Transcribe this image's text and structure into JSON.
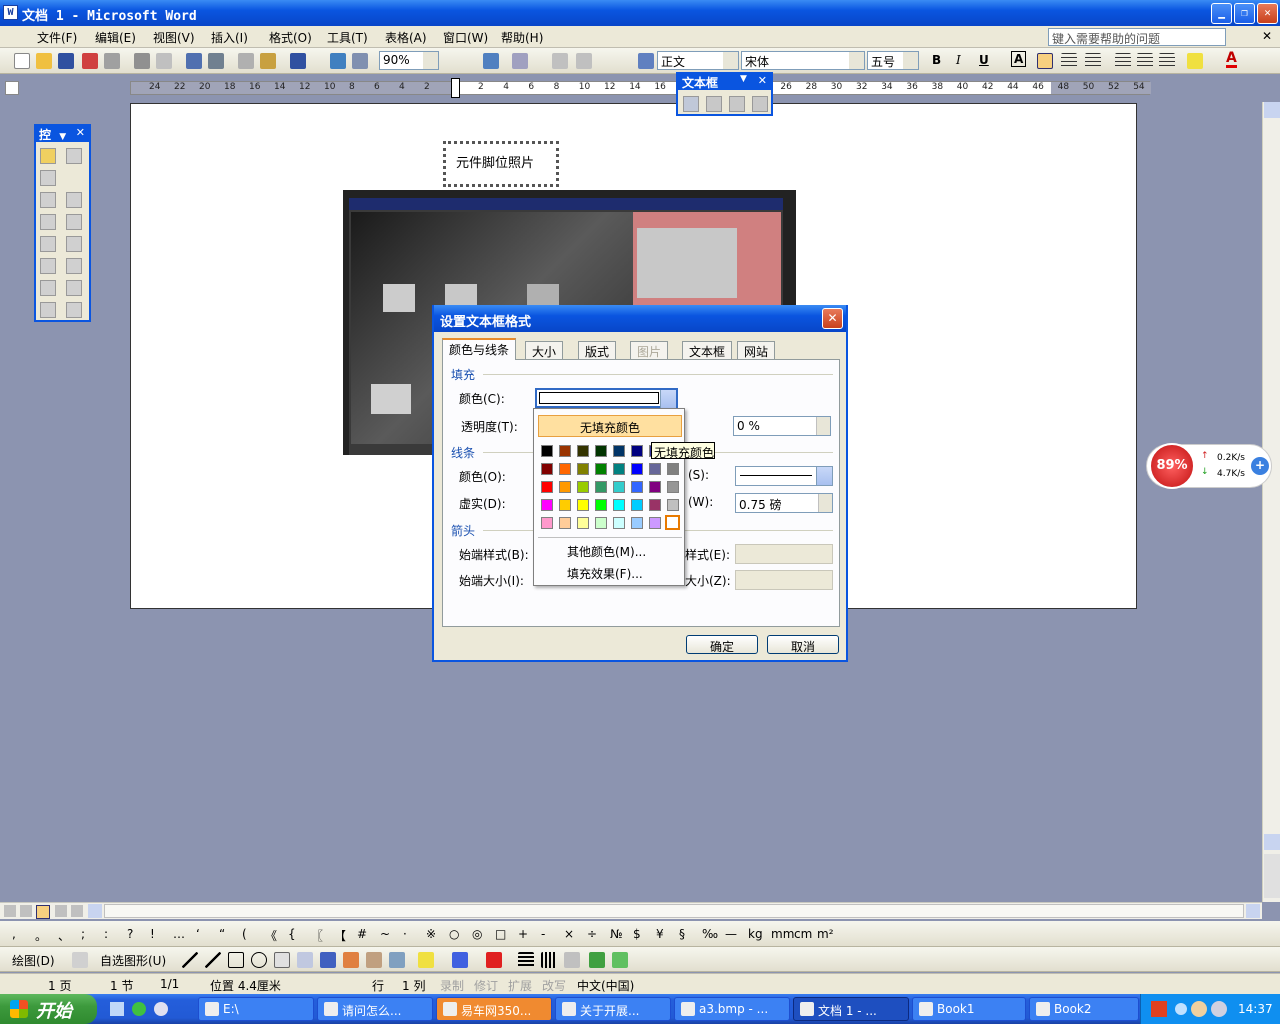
{
  "window": {
    "title": "文档 1 - Microsoft Word",
    "doc_icon": "W",
    "controls": {
      "minimize": "▁",
      "restore": "❐",
      "close": "✕"
    }
  },
  "menu": {
    "items": [
      "文件(F)",
      "编辑(E)",
      "视图(V)",
      "插入(I)",
      "格式(O)",
      "工具(T)",
      "表格(A)",
      "窗口(W)",
      "帮助(H)"
    ],
    "help_placeholder": "键入需要帮助的问题",
    "doc_close": "✕"
  },
  "toolbar": {
    "zoom": "90%",
    "style": "正文",
    "font": "宋体",
    "size": "五号",
    "bold": "B",
    "italic": "I",
    "underline": "U",
    "char_border": "A",
    "font_color": "A"
  },
  "ruler": {
    "left_numbers": [
      "24",
      "22",
      "20",
      "18",
      "16",
      "14",
      "12",
      "10",
      "8",
      "6",
      "4",
      "2"
    ],
    "right_numbers": [
      "2",
      "4",
      "6",
      "8",
      "10",
      "12",
      "14",
      "16",
      "18",
      "20",
      "22",
      "24",
      "26",
      "28",
      "30",
      "32",
      "34",
      "36",
      "38",
      "40",
      "42",
      "44",
      "46",
      "48",
      "50",
      "52",
      "54"
    ]
  },
  "document": {
    "textbox_text": "元件脚位照片"
  },
  "control_toolbox": {
    "title": "控",
    "dropdown": "▼",
    "close": "✕"
  },
  "textbox_toolbar": {
    "title": "文本框",
    "dropdown": "▼",
    "close": "✕"
  },
  "dialog": {
    "title": "设置文本框格式",
    "close": "✕",
    "tabs": [
      {
        "label": "颜色与线条",
        "active": true
      },
      {
        "label": "大小"
      },
      {
        "label": "版式"
      },
      {
        "label": "图片",
        "disabled": true
      },
      {
        "label": "文本框"
      },
      {
        "label": "网站"
      }
    ],
    "fill": {
      "section": "填充",
      "color_label": "颜色(C):",
      "transparency_label": "透明度(T):",
      "transparency_value": "0 %"
    },
    "line": {
      "section": "线条",
      "color_label": "颜色(O):",
      "dash_label": "虚实(D):",
      "style_label_tail": "(S):",
      "weight_label_tail": "(W):",
      "weight_value": "0.75 磅"
    },
    "arrows": {
      "section": "箭头",
      "begin_style": "始端样式(B):",
      "begin_size": "始端大小(I):",
      "end_style_tail": "样式(E):",
      "end_size_tail": "大小(Z):"
    },
    "ok": "确定",
    "cancel": "取消"
  },
  "color_palette": {
    "no_fill": "无填充颜色",
    "rows": [
      [
        "#000000",
        "#993300",
        "#333300",
        "#003300",
        "#003366",
        "#000080",
        "#333399",
        "#333333"
      ],
      [
        "#800000",
        "#ff6600",
        "#808000",
        "#008000",
        "#008080",
        "#0000ff",
        "#666699",
        "#808080"
      ],
      [
        "#ff0000",
        "#ff9900",
        "#99cc00",
        "#339966",
        "#33cccc",
        "#3366ff",
        "#800080",
        "#969696"
      ],
      [
        "#ff00ff",
        "#ffcc00",
        "#ffff00",
        "#00ff00",
        "#00ffff",
        "#00ccff",
        "#993366",
        "#c0c0c0"
      ],
      [
        "#ff99cc",
        "#ffcc99",
        "#ffff99",
        "#ccffcc",
        "#ccffff",
        "#99ccff",
        "#cc99ff",
        "#ffffff"
      ]
    ],
    "more_colors": "其他颜色(M)...",
    "fill_effects": "填充效果(F)..."
  },
  "tooltip": "无填充颜色",
  "net_widget": {
    "percent": "89%",
    "up": "0.2K/s",
    "down": "4.7K/s",
    "plus": "+"
  },
  "symbols": [
    ",",
    "。",
    "、",
    ";",
    ":",
    "?",
    "!",
    "…",
    "‘",
    "“",
    "(",
    "《",
    "{",
    "〖",
    "【",
    "#",
    "~",
    "·",
    "※",
    "○",
    "◎",
    "□",
    "+",
    "-",
    "×",
    "÷",
    "№",
    "$",
    "¥",
    "§",
    "‰",
    "—",
    "kg",
    "mm",
    "cm",
    "m²"
  ],
  "draw_toolbar": {
    "draw": "绘图(D)",
    "autoshapes": "自选图形(U)"
  },
  "status": {
    "page": "1 页",
    "section": "1 节",
    "pages": "1/1",
    "position": "位置 4.4厘米",
    "line": "行",
    "col": "1 列",
    "rec": "录制",
    "trk": "修订",
    "ext": "扩展",
    "ovr": "改写",
    "lang": "中文(中国)"
  },
  "taskbar": {
    "start": "开始",
    "tasks": [
      "E:\\",
      "请问怎么...",
      "易车网350...",
      "关于开展...",
      "a3.bmp - ...",
      "文档 1 - ...",
      "Book1",
      "Book2"
    ],
    "time": "14:37"
  }
}
